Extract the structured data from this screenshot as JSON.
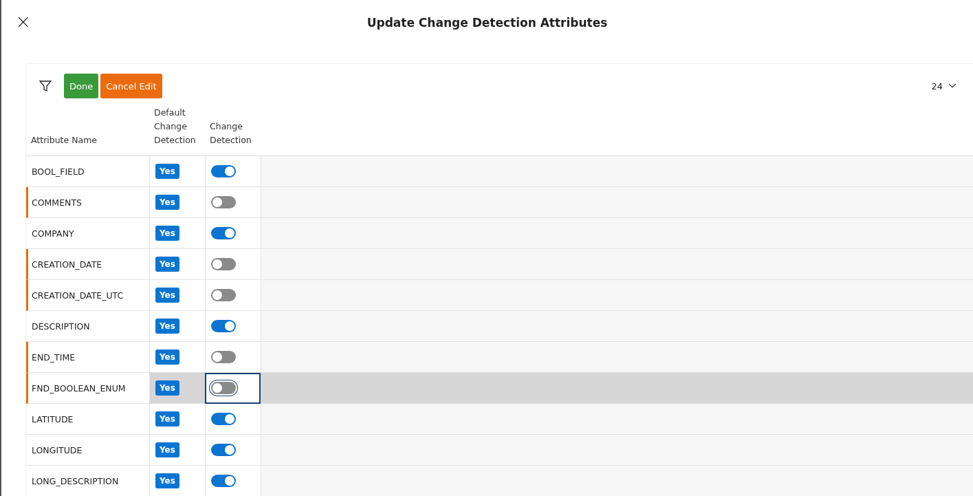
{
  "dialog": {
    "close": "×",
    "title": "Update Change Detection Attributes"
  },
  "toolbar": {
    "buttons": [
      {
        "label": "Done",
        "kind": "primary"
      },
      {
        "label": "Cancel Edit",
        "kind": "warning"
      }
    ],
    "page_size": "24"
  },
  "table": {
    "columns": [
      "Attribute Name",
      "Default Change Detection",
      "Change Detection"
    ],
    "rows": [
      {
        "name": "BOOL_FIELD",
        "default": "Yes",
        "on": true,
        "modified": false,
        "selected": false
      },
      {
        "name": "COMMENTS",
        "default": "Yes",
        "on": false,
        "modified": true,
        "selected": false
      },
      {
        "name": "COMPANY",
        "default": "Yes",
        "on": true,
        "modified": false,
        "selected": false
      },
      {
        "name": "CREATION_DATE",
        "default": "Yes",
        "on": false,
        "modified": true,
        "selected": false
      },
      {
        "name": "CREATION_DATE_UTC",
        "default": "Yes",
        "on": false,
        "modified": true,
        "selected": false
      },
      {
        "name": "DESCRIPTION",
        "default": "Yes",
        "on": true,
        "modified": false,
        "selected": false
      },
      {
        "name": "END_TIME",
        "default": "Yes",
        "on": false,
        "modified": true,
        "selected": false
      },
      {
        "name": "FND_BOOLEAN_ENUM",
        "default": "Yes",
        "on": false,
        "modified": true,
        "selected": true
      },
      {
        "name": "LATITUDE",
        "default": "Yes",
        "on": true,
        "modified": false,
        "selected": false
      },
      {
        "name": "LONGITUDE",
        "default": "Yes",
        "on": true,
        "modified": false,
        "selected": false
      },
      {
        "name": "LONG_DESCRIPTION",
        "default": "Yes",
        "on": true,
        "modified": false,
        "selected": false
      }
    ]
  }
}
